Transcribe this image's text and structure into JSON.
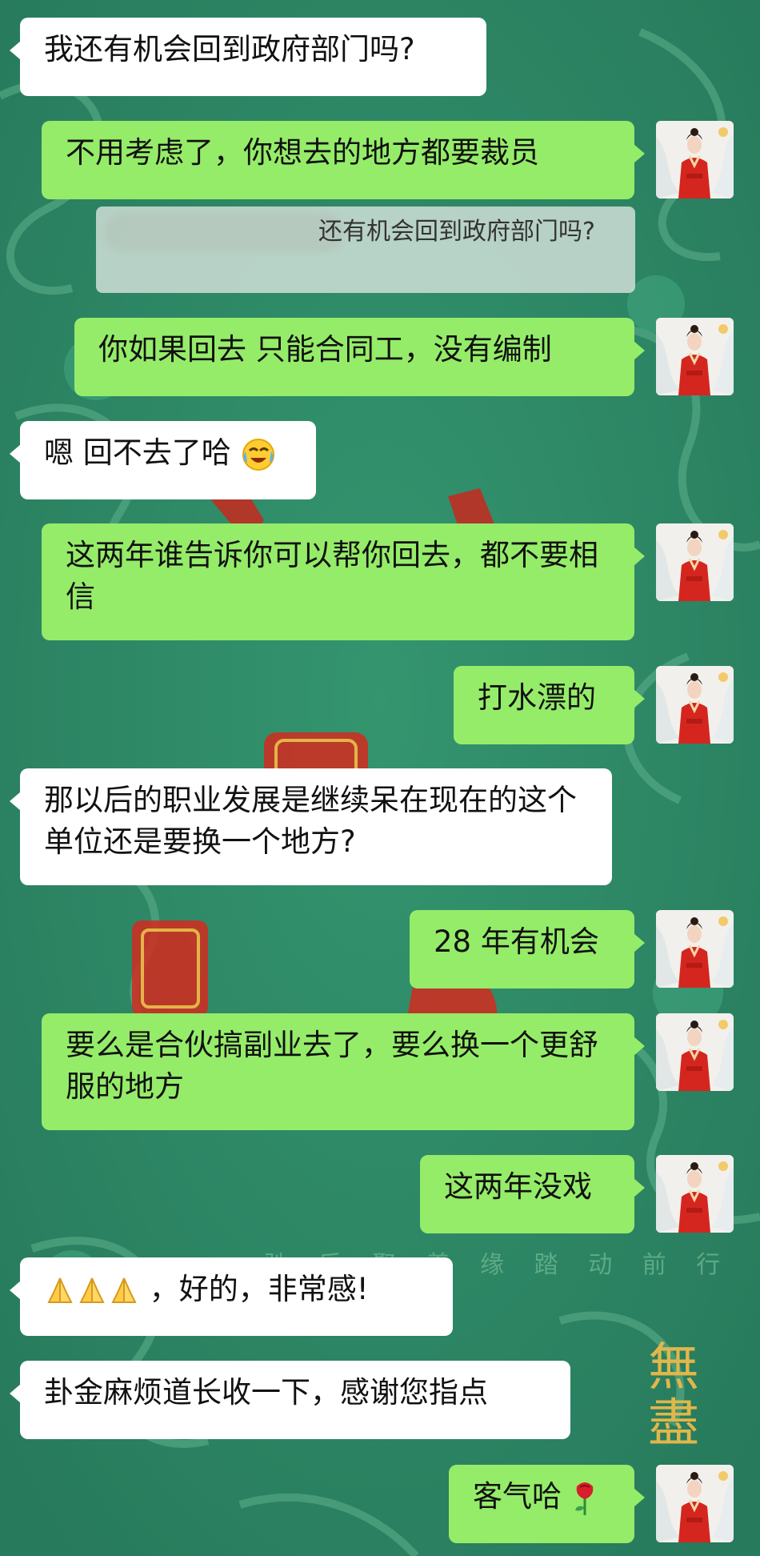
{
  "messages": [
    {
      "side": "left",
      "text": "我还有机会回到政府部门吗?"
    },
    {
      "side": "right",
      "text": "不用考虑了，你想去的地方都要裁员"
    },
    {
      "side": "right",
      "text": "你如果回去 只能合同工，没有编制"
    },
    {
      "side": "left",
      "text": "嗯 回不去了哈"
    },
    {
      "side": "right",
      "text": "这两年谁告诉你可以帮你回去，都不要相信"
    },
    {
      "side": "right",
      "text": "打水漂的"
    },
    {
      "side": "left",
      "text": "那以后的职业发展是继续呆在现在的这个单位还是要换一个地方?"
    },
    {
      "side": "right",
      "text": "28 年有机会"
    },
    {
      "side": "right",
      "text": "要么是合伙搞副业去了，要么换一个更舒服的地方"
    },
    {
      "side": "right",
      "text": "这两年没戏"
    },
    {
      "side": "left",
      "text": "，好的，非常感!"
    },
    {
      "side": "left",
      "text": "卦金麻烦道长收一下，感谢您指点"
    },
    {
      "side": "right",
      "text": "客气哈"
    }
  ],
  "quote": {
    "text": "还有机会回到政府部门吗?"
  },
  "background": {
    "texts": [
      "驰 乐 聚 善 缘 踏 动 前 行",
      "無",
      "盡"
    ]
  },
  "colors": {
    "bg": "#2f8a68",
    "green_bubble": "#95ec69",
    "white_bubble": "#ffffff"
  },
  "emojis": [
    "face-with-tears-emoji",
    "praying-hands-emoji",
    "rose-emoji"
  ]
}
